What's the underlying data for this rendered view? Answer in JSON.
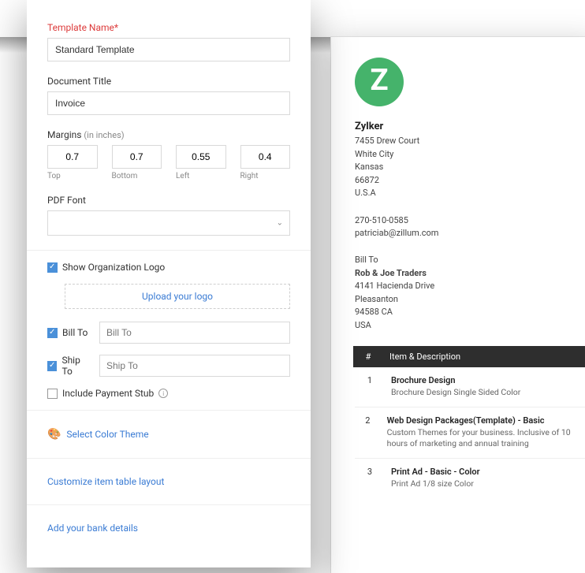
{
  "form": {
    "template_name_label": "Template Name*",
    "template_name_value": "Standard Template",
    "doc_title_label": "Document Title",
    "doc_title_value": "Invoice",
    "margins_label": "Margins",
    "margins_hint": "(in inches)",
    "margins": {
      "top": {
        "value": "0.7",
        "label": "Top"
      },
      "bottom": {
        "value": "0.7",
        "label": "Bottom"
      },
      "left": {
        "value": "0.55",
        "label": "Left"
      },
      "right": {
        "value": "0.4",
        "label": "Right"
      }
    },
    "pdf_font_label": "PDF Font",
    "show_logo_label": "Show Organization Logo",
    "upload_logo_label": "Upload your logo",
    "bill_to_label": "Bill To",
    "bill_to_placeholder": "Bill To",
    "ship_to_label": "Ship To",
    "ship_to_placeholder": "Ship To",
    "payment_stub_label": "Include Payment Stub",
    "color_theme_label": "Select Color Theme",
    "customize_table_label": "Customize item table layout",
    "bank_details_label": "Add your bank details"
  },
  "preview": {
    "logo_letter": "Z",
    "org_name": "Zylker",
    "org_addr": [
      "7455 Drew Court",
      "White City",
      "Kansas",
      "66872",
      "U.S.A"
    ],
    "contact": [
      "270-510-0585",
      "patriciab@zillum.com"
    ],
    "bill_to_heading": "Bill To",
    "bill_to_name": "Rob & Joe Traders",
    "bill_to_addr": [
      "4141 Hacienda Drive",
      "Pleasanton",
      "94588 CA",
      "USA"
    ],
    "table": {
      "col_num": "#",
      "col_desc": "Item & Description",
      "rows": [
        {
          "num": "1",
          "title": "Brochure Design",
          "desc": "Brochure Design Single Sided Color"
        },
        {
          "num": "2",
          "title": "Web Design Packages(Template) - Basic",
          "desc": "Custom Themes for your business. Inclusive of 10 hours of marketing and annual training"
        },
        {
          "num": "3",
          "title": "Print Ad - Basic - Color",
          "desc": "Print Ad 1/8 size Color"
        }
      ]
    }
  }
}
